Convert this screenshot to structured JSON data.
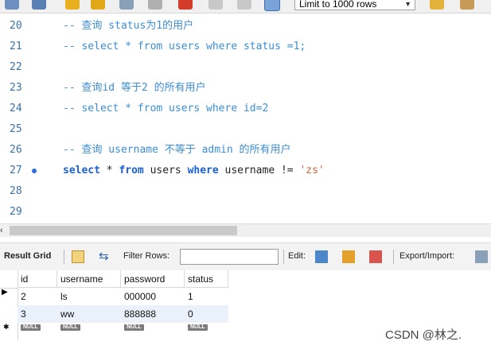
{
  "toolbar": {
    "limit_select": "Limit to 1000 rows"
  },
  "editor": {
    "lines": [
      {
        "num": "20",
        "segments": [
          {
            "t": "-- 查询 status为1的用户",
            "c": "cm"
          }
        ]
      },
      {
        "num": "21",
        "segments": [
          {
            "t": "-- select * from users where status =1;",
            "c": "cm"
          }
        ]
      },
      {
        "num": "22",
        "segments": []
      },
      {
        "num": "23",
        "segments": [
          {
            "t": "-- 查询id 等于2 的所有用户",
            "c": "cm"
          }
        ]
      },
      {
        "num": "24",
        "segments": [
          {
            "t": "-- select * from users where id=2",
            "c": "cm"
          }
        ]
      },
      {
        "num": "25",
        "segments": []
      },
      {
        "num": "26",
        "segments": [
          {
            "t": "-- 查询 username 不等于 admin 的所有用户",
            "c": "cm"
          }
        ]
      },
      {
        "num": "27",
        "segments": [
          {
            "t": "select",
            "c": "kw"
          },
          {
            "t": " * ",
            "c": "pl"
          },
          {
            "t": "from",
            "c": "kw"
          },
          {
            "t": " users ",
            "c": "pl"
          },
          {
            "t": "where",
            "c": "kw"
          },
          {
            "t": " username != ",
            "c": "pl"
          },
          {
            "t": "'zs'",
            "c": "str"
          }
        ]
      },
      {
        "num": "28",
        "segments": []
      },
      {
        "num": "29",
        "segments": []
      }
    ]
  },
  "results": {
    "result_grid_label": "Result Grid",
    "filter_rows_label": "Filter Rows:",
    "filter_value": "",
    "edit_label": "Edit:",
    "export_label": "Export/Import:",
    "columns": [
      "id",
      "username",
      "password",
      "status"
    ],
    "rows": [
      [
        "2",
        "ls",
        "000000",
        "1"
      ],
      [
        "3",
        "ww",
        "888888",
        "0"
      ]
    ],
    "null_label": "NULL"
  },
  "watermark": "CSDN @林之."
}
